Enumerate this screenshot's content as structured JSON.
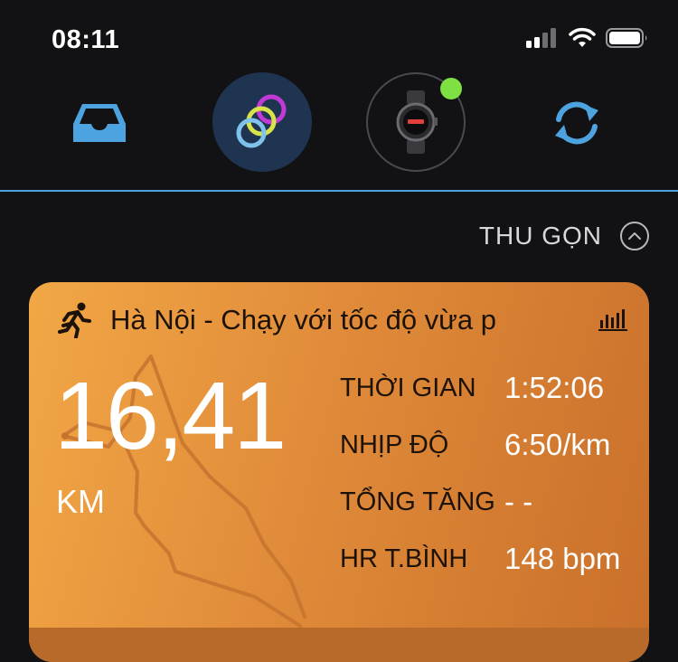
{
  "status_bar": {
    "time": "08:11"
  },
  "toolbar": {
    "inbox": {
      "icon": "inbox-tray-icon"
    },
    "connect": {
      "icon": "connect-rings-icon"
    },
    "device": {
      "icon": "smartwatch-icon",
      "connected_color": "#7ee042"
    },
    "sync": {
      "icon": "sync-icon"
    },
    "accent_color": "#4da3e0"
  },
  "collapse": {
    "label": "THU GỌN"
  },
  "activity": {
    "title": "Hà Nội - Chạy với tốc độ vừa p",
    "distance": "16,41",
    "unit": "KM",
    "metrics": [
      {
        "label": "THỜI GIAN",
        "value": "1:52:06"
      },
      {
        "label": "NHỊP ĐỘ",
        "value": "6:50/km"
      },
      {
        "label": "TỔNG TĂNG",
        "value": "- -"
      },
      {
        "label": "HR T.BÌNH",
        "value": "148 bpm"
      }
    ]
  }
}
